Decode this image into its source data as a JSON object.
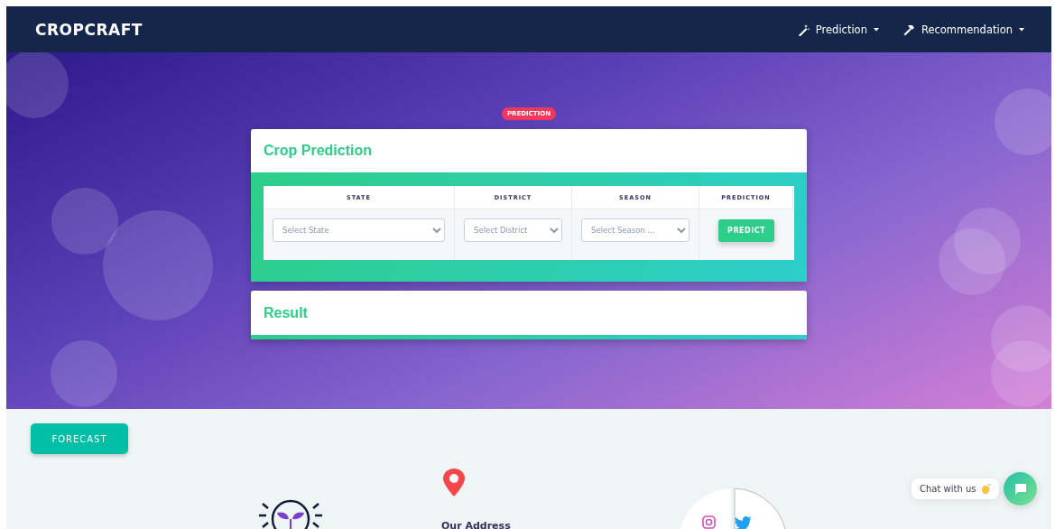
{
  "navbar": {
    "brand": "CROPCRAFT",
    "menus": [
      {
        "label": "Prediction",
        "kind": "wand"
      },
      {
        "label": "Recommendation",
        "kind": "hammer"
      }
    ]
  },
  "badge": "PREDICTION",
  "prediction_card": {
    "title": "Crop Prediction",
    "columns": [
      "STATE",
      "DISTRICT",
      "SEASON",
      "PREDICTION"
    ],
    "fields": [
      {
        "placeholder": "Select State"
      },
      {
        "placeholder": "Select District"
      },
      {
        "placeholder": "Select Season ..."
      }
    ],
    "button": "PREDICT"
  },
  "result_card": {
    "title": "Result"
  },
  "forecast_button": "FORECAST",
  "footer": {
    "address_title": "Our Address",
    "social": [
      {
        "kind": "instagram"
      },
      {
        "kind": "twitter"
      }
    ]
  },
  "chat": {
    "label": "Chat with us"
  }
}
